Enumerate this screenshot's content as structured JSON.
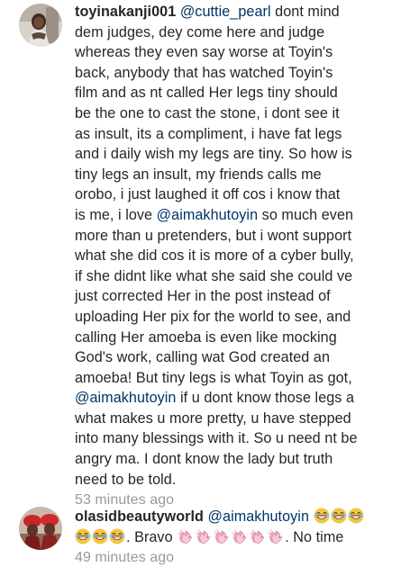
{
  "comments": [
    {
      "username": "toyinakanji001",
      "lines": [
        [
          {
            "t": "@cuttie_pearl",
            "m": true
          },
          {
            "t": " dont mind"
          }
        ],
        [
          {
            "t": "dem judges, dey come here and judge"
          }
        ],
        [
          {
            "t": "whereas they even say worse at Toyin's"
          }
        ],
        [
          {
            "t": "back, anybody that has watched Toyin's"
          }
        ],
        [
          {
            "t": "film and as nt called Her legs tiny should"
          }
        ],
        [
          {
            "t": "be the one to cast the stone, i dont see it"
          }
        ],
        [
          {
            "t": "as insult, its a compliment, i have fat legs"
          }
        ],
        [
          {
            "t": "and i daily wish my legs are tiny. So how is"
          }
        ],
        [
          {
            "t": "tiny legs an insult, my friends calls me"
          }
        ],
        [
          {
            "t": "orobo, i just laughed it off cos i know that"
          }
        ],
        [
          {
            "t": "is me, i love "
          },
          {
            "t": "@aimakhutoyin",
            "m": true
          },
          {
            "t": " so much even"
          }
        ],
        [
          {
            "t": "more than u pretenders, but i wont support"
          }
        ],
        [
          {
            "t": "what she did cos it is more of a cyber bully,"
          }
        ],
        [
          {
            "t": "if she didnt like what she said she could ve"
          }
        ],
        [
          {
            "t": "just corrected Her in the post instead of"
          }
        ],
        [
          {
            "t": "uploading Her pix for the world to see, and"
          }
        ],
        [
          {
            "t": "calling Her amoeba is even like mocking"
          }
        ],
        [
          {
            "t": "God's work, calling wat God created an"
          }
        ],
        [
          {
            "t": "amoeba! But tiny legs is what Toyin as got,"
          }
        ],
        [
          {
            "t": "@aimakhutoyin",
            "m": true
          },
          {
            "t": " if u dont know those legs a"
          }
        ],
        [
          {
            "t": "what makes u more pretty, u have stepped"
          }
        ],
        [
          {
            "t": "into many blessings with it. So u need nt be"
          }
        ],
        [
          {
            "t": "angry ma. I dont know the lady but truth"
          }
        ],
        [
          {
            "t": "need to be told."
          }
        ]
      ],
      "timestamp": "53 minutes ago"
    },
    {
      "username": "olasidbeautyworld",
      "lines": [
        [
          {
            "t": "@aimakhutoyin",
            "m": true
          },
          {
            "t": " "
          },
          {
            "e": "grin"
          },
          {
            "e": "grin"
          },
          {
            "e": "grin"
          }
        ],
        [
          {
            "e": "grin"
          },
          {
            "e": "grin"
          },
          {
            "e": "grin"
          },
          {
            "t": ". Bravo "
          },
          {
            "e": "clap"
          },
          {
            "e": "clap"
          },
          {
            "e": "clap"
          },
          {
            "e": "clap"
          },
          {
            "e": "clap"
          },
          {
            "e": "clap"
          },
          {
            "t": ". No time"
          }
        ]
      ],
      "timestamp": "49 minutes ago"
    }
  ],
  "icons": {
    "grin": "grinning-face-emoji",
    "clap": "clapping-hands-emoji"
  },
  "colors": {
    "text": "#262626",
    "mention": "#003569",
    "timestamp": "#999999"
  }
}
